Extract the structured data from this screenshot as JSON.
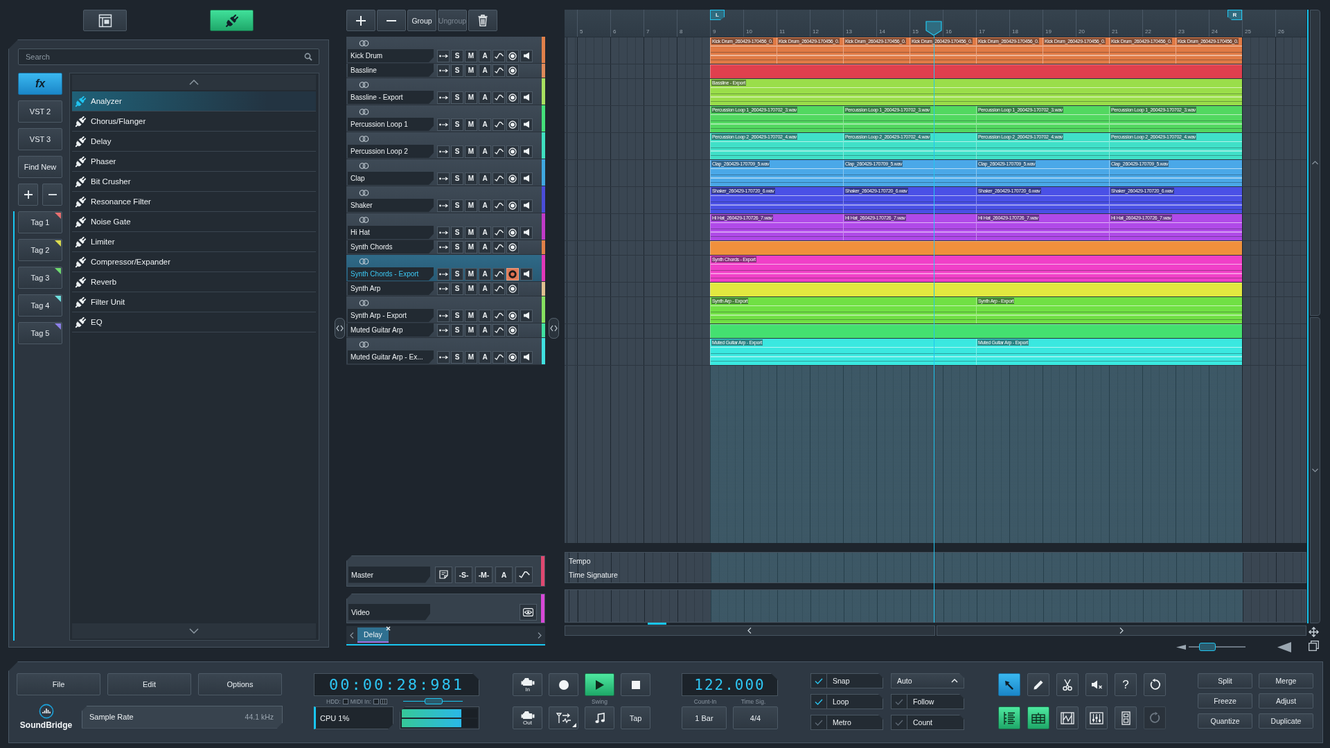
{
  "top_buttons": [
    {
      "kind": "layout",
      "selected": false
    },
    {
      "kind": "plugins",
      "selected": true
    }
  ],
  "browser": {
    "search": {
      "placeholder": "Search"
    },
    "categories": [
      {
        "label": "fx",
        "selected": true
      },
      {
        "label": "VST 2",
        "selected": false
      },
      {
        "label": "VST 3",
        "selected": false
      },
      {
        "label": "Find New",
        "selected": false
      }
    ],
    "tags": [
      {
        "label": "Tag 1",
        "color": "#e87070"
      },
      {
        "label": "Tag 2",
        "color": "#dcdc50"
      },
      {
        "label": "Tag 3",
        "color": "#70dc70"
      },
      {
        "label": "Tag 4",
        "color": "#70e0e0"
      },
      {
        "label": "Tag 5",
        "color": "#8c80e8"
      }
    ],
    "plugins": [
      {
        "name": "Analyzer",
        "selected": true
      },
      {
        "name": "Chorus/Flanger",
        "selected": false
      },
      {
        "name": "Delay",
        "selected": false
      },
      {
        "name": "Phaser",
        "selected": false
      },
      {
        "name": "Bit Crusher",
        "selected": false
      },
      {
        "name": "Resonance Filter",
        "selected": false
      },
      {
        "name": "Noise Gate",
        "selected": false
      },
      {
        "name": "Limiter",
        "selected": false
      },
      {
        "name": "Compressor/Expander",
        "selected": false
      },
      {
        "name": "Reverb",
        "selected": false
      },
      {
        "name": "Filter Unit",
        "selected": false
      },
      {
        "name": "EQ",
        "selected": false
      }
    ]
  },
  "track_toolbar": [
    {
      "kind": "add"
    },
    {
      "kind": "remove"
    },
    {
      "kind": "group",
      "label": "Group",
      "disabled": false
    },
    {
      "kind": "ungroup",
      "label": "Ungroup",
      "disabled": true
    },
    {
      "kind": "delete"
    }
  ],
  "tracks": [
    {
      "name": "Kick Drum",
      "kind": "audio",
      "color": "#e0804a",
      "lane": {
        "color": "#e07a45"
      },
      "selected": false,
      "armed": false,
      "buttons": [
        "S",
        "M",
        "A"
      ],
      "clips": [
        "Kick Drum_260429-170456_0.",
        "Kick Drum_260429-170456_0.",
        "Kick Drum_260429-170456_0.",
        "Kick Drum_260429-170456_0.",
        "Kick Drum_260429-170456_0.",
        "Kick Drum_260429-170456_0.",
        "Kick Drum_260429-170456_0.",
        "Kick Drum_260429-170456_0."
      ]
    },
    {
      "name": "Bassline",
      "kind": "midi",
      "color": "#e08a5a",
      "lane": {
        "color": "#e0404e"
      },
      "selected": false,
      "armed": false,
      "buttons": [
        "S",
        "M",
        "A"
      ]
    },
    {
      "name": "Bassline - Export",
      "kind": "audio",
      "color": "#a8e060",
      "lane": {
        "color": "#9ade4a"
      },
      "selected": false,
      "armed": false,
      "buttons": [
        "S",
        "M",
        "A"
      ],
      "clips": [
        "Bassline - Export"
      ]
    },
    {
      "name": "Percussion Loop 1",
      "kind": "audio",
      "color": "#44e07a",
      "lane": {
        "color": "#52d860"
      },
      "selected": false,
      "armed": false,
      "buttons": [
        "S",
        "M",
        "A"
      ],
      "clips": [
        "Percussion Loop 1_260429-170702_3.wav",
        "Percussion Loop 1_260429-170702_3.wav",
        "Percussion Loop 1_260429-170702_3.wav",
        "Percussion Loop 1_260429-170702_3.wav"
      ]
    },
    {
      "name": "Percussion Loop 2",
      "kind": "audio",
      "color": "#3fe0c0",
      "lane": {
        "color": "#40e0c8"
      },
      "selected": false,
      "armed": false,
      "buttons": [
        "S",
        "M",
        "A"
      ],
      "clips": [
        "Percussion Loop 2_260429-170702_4.wav",
        "Percussion Loop 2_260429-170702_4.wav",
        "Percussion Loop 2_260429-170702_4.wav",
        "Percussion Loop 2_260429-170702_4.wav"
      ]
    },
    {
      "name": "Clap",
      "kind": "audio",
      "color": "#3fa8e0",
      "lane": {
        "color": "#4aa8e8"
      },
      "selected": false,
      "armed": false,
      "buttons": [
        "S",
        "M",
        "A"
      ],
      "clips": [
        "Clap_260429-170709_5.wav",
        "Clap_260429-170709_5.wav",
        "Clap_260429-170709_5.wav",
        "Clap_260429-170709_5.wav"
      ]
    },
    {
      "name": "Shaker",
      "kind": "audio",
      "color": "#4a4cd8",
      "lane": {
        "color": "#4a50e6"
      },
      "selected": false,
      "armed": false,
      "buttons": [
        "S",
        "M",
        "A"
      ],
      "clips": [
        "Shaker_260429-170720_6.wav",
        "Shaker_260429-170720_6.wav",
        "Shaker_260429-170720_6.wav",
        "Shaker_260429-170720_6.wav"
      ]
    },
    {
      "name": "Hi Hat",
      "kind": "audio",
      "color": "#c03ac8",
      "lane": {
        "color": "#b04ae8"
      },
      "selected": false,
      "armed": false,
      "buttons": [
        "S",
        "M",
        "A"
      ],
      "clips": [
        "Hi Hat_260429-170726_7.wav",
        "Hi Hat_260429-170726_7.wav",
        "Hi Hat_260429-170726_7.wav",
        "Hi Hat_260429-170726_7.wav"
      ]
    },
    {
      "name": "Synth Chords",
      "kind": "midi",
      "color": "#e08048",
      "lane": {
        "color": "#f0903c"
      },
      "selected": false,
      "armed": false,
      "buttons": [
        "S",
        "M",
        "A"
      ]
    },
    {
      "name": "Synth Chords - Export",
      "kind": "audio",
      "color": "#e038b8",
      "lane": {
        "color": "#f040c8"
      },
      "selected": true,
      "armed": true,
      "buttons": [
        "S",
        "M",
        "A"
      ],
      "clips": [
        "Synth Chords - Export"
      ]
    },
    {
      "name": "Synth Arp",
      "kind": "midi",
      "color": "#e0c090",
      "lane": {
        "color": "#e2e840"
      },
      "selected": false,
      "armed": false,
      "buttons": [
        "S",
        "M",
        "A"
      ]
    },
    {
      "name": "Synth Arp - Export",
      "kind": "audio",
      "color": "#86e060",
      "lane": {
        "color": "#70e044"
      },
      "selected": false,
      "armed": false,
      "buttons": [
        "S",
        "M",
        "A"
      ],
      "clips": [
        "Synth Arp - Export",
        "Synth Arp - Export"
      ]
    },
    {
      "name": "Muted Guitar Arp",
      "kind": "midi",
      "color": "#40e0a0",
      "lane": {
        "color": "#44e070"
      },
      "selected": false,
      "armed": false,
      "buttons": [
        "S",
        "M",
        "A"
      ]
    },
    {
      "name": "Muted Guitar Arp - Ex...",
      "kind": "audio",
      "color": "#40e0e0",
      "lane": {
        "color": "#3ae8e0"
      },
      "selected": false,
      "armed": false,
      "buttons": [
        "S",
        "M",
        "A"
      ],
      "clips": [
        "Muted Guitar Arp - Export",
        "Muted Guitar Arp - Export"
      ]
    }
  ],
  "master": {
    "name": "Master",
    "buttons": [
      "-S-",
      "-M-",
      "A"
    ],
    "color": "#e04870"
  },
  "video": {
    "name": "Video",
    "color": "#d848d8"
  },
  "editor_tabs": [
    {
      "label": "Delay",
      "selected": true
    }
  ],
  "ruler": {
    "bars": [
      {
        "label": "5"
      },
      {
        "label": "6"
      },
      {
        "label": "7"
      },
      {
        "label": "8"
      },
      {
        "label": "9",
        "marker": "L"
      },
      {
        "label": "10"
      },
      {
        "label": "11"
      },
      {
        "label": "12"
      },
      {
        "label": "13"
      },
      {
        "label": "14"
      },
      {
        "label": "15"
      },
      {
        "label": "16"
      },
      {
        "label": "17"
      },
      {
        "label": "18"
      },
      {
        "label": "19"
      },
      {
        "label": "20"
      },
      {
        "label": "21"
      },
      {
        "label": "22"
      },
      {
        "label": "23"
      },
      {
        "label": "24"
      },
      {
        "label": "25",
        "marker": "R"
      },
      {
        "label": "26"
      }
    ],
    "playhead": {
      "level": 0.498
    }
  },
  "tempo_lanes": [
    "Tempo",
    "Time Signature"
  ],
  "zoom": {
    "level": 0.25
  },
  "bottom": {
    "menu": [
      "File",
      "Edit",
      "Options"
    ],
    "logo": "SoundBridge",
    "sample_rate": {
      "label": "Sample Rate",
      "value": "44.1 kHz"
    },
    "time": "00:00:28:981",
    "hdd_label": "HDD:",
    "midi_label": "MIDI In:",
    "small_slider": {
      "level": 0.53
    },
    "cpu": "CPU 1%",
    "meters": [
      {
        "level": 0.79
      },
      {
        "level": 0.79
      }
    ],
    "transport": [
      {
        "kind": "in",
        "label": "In",
        "selected": false
      },
      {
        "kind": "record",
        "selected": false
      },
      {
        "kind": "play",
        "selected": true
      },
      {
        "kind": "stop",
        "selected": false
      },
      {
        "kind": "out",
        "label": "Out",
        "selected": false
      },
      {
        "kind": "routing",
        "selected": false
      },
      {
        "kind": "metronome",
        "selected": false
      },
      {
        "kind": "tap",
        "label": "Tap",
        "selected": false
      }
    ],
    "swing_label": "Swing",
    "tempo": "122.000",
    "count_in": {
      "label": "Count-In",
      "value": "1 Bar"
    },
    "time_sig": {
      "label": "Time Sig.",
      "value": "4/4"
    },
    "toggles": [
      {
        "kind": "check",
        "label": "Snap",
        "checked": true
      },
      {
        "kind": "dropdown",
        "label": "Auto"
      },
      {
        "kind": "check",
        "label": "Loop",
        "checked": true
      },
      {
        "kind": "check",
        "label": "Follow",
        "checked": false
      },
      {
        "kind": "check",
        "label": "Metro",
        "checked": false
      },
      {
        "kind": "check",
        "label": "Count",
        "checked": false
      }
    ],
    "tool_rows": [
      {
        "items": [
          {
            "kind": "pointer",
            "selected": true,
            "disabled": false
          },
          {
            "kind": "pencil",
            "selected": false,
            "disabled": false
          },
          {
            "kind": "scissors",
            "selected": false,
            "disabled": false
          },
          {
            "kind": "mute",
            "selected": false,
            "disabled": false
          },
          {
            "kind": "help",
            "label": "?",
            "selected": false,
            "disabled": false
          },
          {
            "kind": "undo",
            "selected": false,
            "disabled": false
          }
        ]
      },
      {
        "items": [
          {
            "kind": "tracks",
            "selected": true,
            "disabled": false
          },
          {
            "kind": "editor",
            "selected": true,
            "disabled": false
          },
          {
            "kind": "automation",
            "selected": false,
            "disabled": false
          },
          {
            "kind": "mixer",
            "selected": false,
            "disabled": false
          },
          {
            "kind": "device",
            "selected": false,
            "disabled": false
          },
          {
            "kind": "redo",
            "selected": false,
            "disabled": true
          }
        ]
      }
    ],
    "edit_buttons": [
      "Split",
      "Merge",
      "Freeze",
      "Adjust",
      "Quantize",
      "Duplicate"
    ]
  }
}
